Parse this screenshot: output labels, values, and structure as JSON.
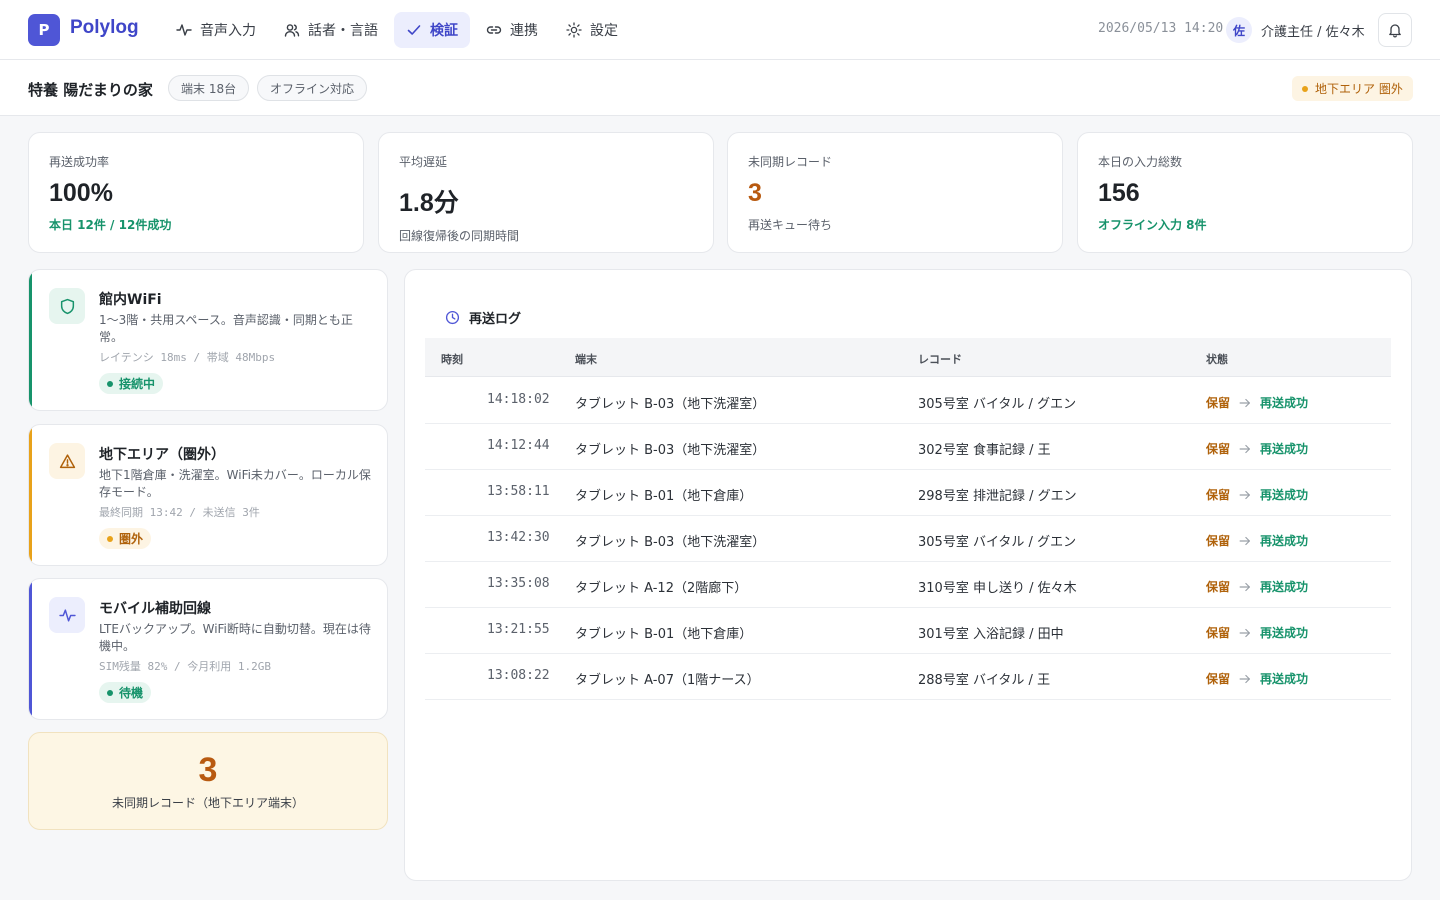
{
  "app": {
    "logo_letter": "P",
    "name": "Polylog"
  },
  "nav": [
    {
      "label": "音声入力",
      "icon": "activity-icon",
      "active": false
    },
    {
      "label": "話者・言語",
      "icon": "users-icon",
      "active": false
    },
    {
      "label": "検証",
      "icon": "check-icon",
      "active": true
    },
    {
      "label": "連携",
      "icon": "link-icon",
      "active": false
    },
    {
      "label": "設定",
      "icon": "sun-icon",
      "active": false
    }
  ],
  "header": {
    "datetime": "2026/05/13 14:20",
    "avatar_initial": "佐",
    "user": "介護主任 / 佐々木",
    "notifications_icon": "bell-icon"
  },
  "facility": {
    "name": "特養 陽だまりの家",
    "terminals_chip": "端末 18台",
    "offline_chip": "オフライン対応",
    "alert": "地下エリア 圏外",
    "alert_color": "#e8a21a"
  },
  "stats": [
    {
      "label": "再送成功率",
      "value": "100%",
      "sub": "本日 12件 / 12件成功",
      "sub_style": "green",
      "value_style": ""
    },
    {
      "label": "平均遅延",
      "value": "1.8分",
      "sub": "回線復帰後の同期時間",
      "sub_style": "gray",
      "value_style": ""
    },
    {
      "label": "未同期レコード",
      "value": "3",
      "sub": "再送キュー待ち",
      "sub_style": "gray",
      "value_style": "orange"
    },
    {
      "label": "本日の入力総数",
      "value": "156",
      "sub": "オフライン入力 8件",
      "sub_style": "green",
      "value_style": ""
    }
  ],
  "networks": [
    {
      "title": "館内WiFi",
      "desc": "1〜3階・共用スペース。音声認識・同期とも正常。",
      "meta": "レイテンシ 18ms / 帯域 48Mbps",
      "badge": "接続中",
      "icon": "shield-icon",
      "color": "#17936b",
      "icon_bg": "#e6f5ef",
      "badge_bg": "#e6f5ef"
    },
    {
      "title": "地下エリア（圏外）",
      "desc": "地下1階倉庫・洗濯室。WiFi未カバー。ローカル保存モード。",
      "meta": "最終同期 13:42 / 未送信 3件",
      "badge": "圏外",
      "icon": "warning-icon",
      "color": "#e8a21a",
      "icon_bg": "#fdf4e3",
      "badge_bg": "#fdf4e3",
      "badge_text_color": "#b0620b"
    },
    {
      "title": "モバイル補助回線",
      "desc": "LTEバックアップ。WiFi断時に自動切替。現在は待機中。",
      "meta": "SIM残量 82% / 今月利用 1.2GB",
      "badge": "待機",
      "icon": "pulse-icon",
      "color": "#4f56d6",
      "icon_bg": "#eceefd",
      "badge_bg": "#e6f5ef",
      "badge_text_color": "#17936b"
    }
  ],
  "unsynced": {
    "count": "3",
    "caption": "未同期レコード（地下エリア端末）"
  },
  "log": {
    "title": "再送ログ",
    "columns": [
      "時刻",
      "端末",
      "レコード",
      "状態"
    ],
    "rows": [
      {
        "time": "14:18:02",
        "terminal": "タブレット B-03（地下洗濯室）",
        "record": "305号室 バイタル / グエン",
        "from": "保留",
        "to": "再送成功"
      },
      {
        "time": "14:12:44",
        "terminal": "タブレット B-03（地下洗濯室）",
        "record": "302号室 食事記録 / 王",
        "from": "保留",
        "to": "再送成功"
      },
      {
        "time": "13:58:11",
        "terminal": "タブレット B-01（地下倉庫）",
        "record": "298号室 排泄記録 / グエン",
        "from": "保留",
        "to": "再送成功"
      },
      {
        "time": "13:42:30",
        "terminal": "タブレット B-03（地下洗濯室）",
        "record": "305号室 バイタル / グエン",
        "from": "保留",
        "to": "再送成功"
      },
      {
        "time": "13:35:08",
        "terminal": "タブレット A-12（2階廊下）",
        "record": "310号室 申し送り / 佐々木",
        "from": "保留",
        "to": "再送成功"
      },
      {
        "time": "13:21:55",
        "terminal": "タブレット B-01（地下倉庫）",
        "record": "301号室 入浴記録 / 田中",
        "from": "保留",
        "to": "再送成功"
      },
      {
        "time": "13:08:22",
        "terminal": "タブレット A-07（1階ナース）",
        "record": "288号室 バイタル / 王",
        "from": "保留",
        "to": "再送成功"
      }
    ]
  }
}
